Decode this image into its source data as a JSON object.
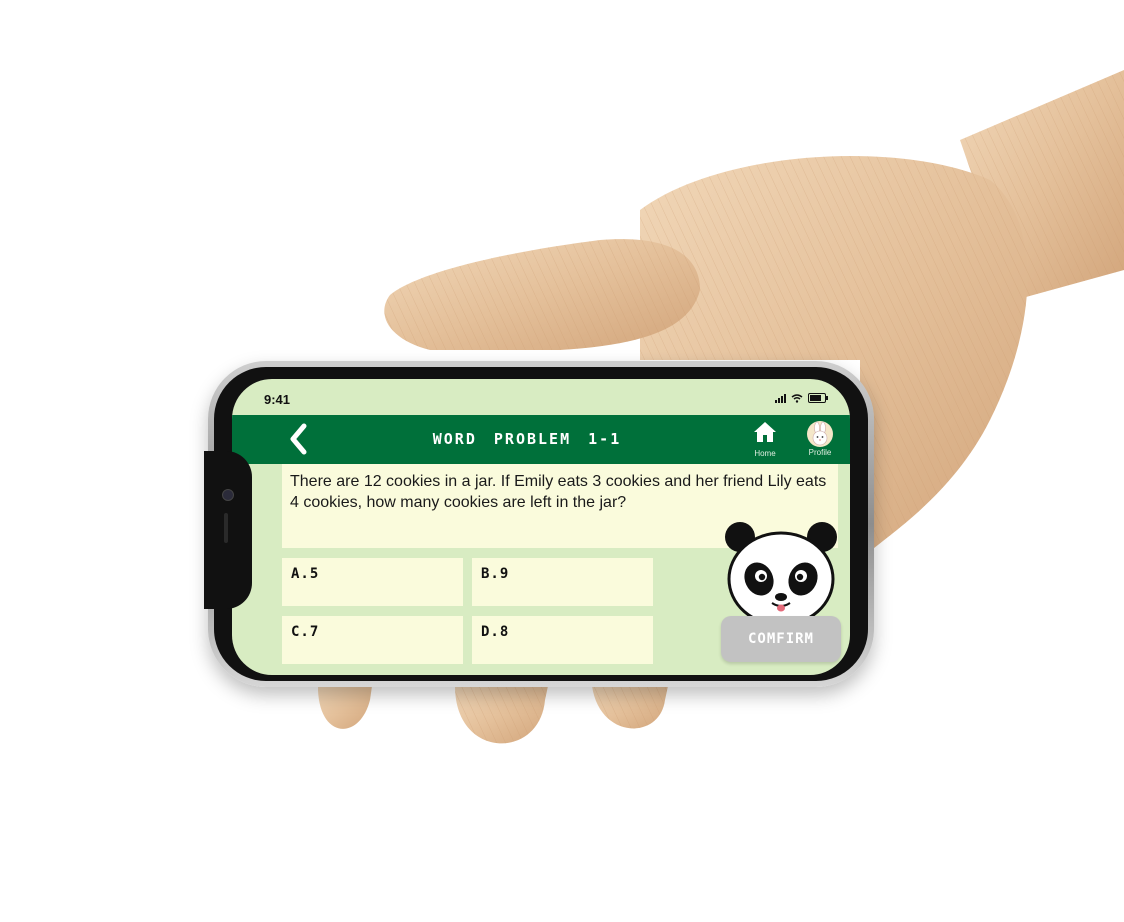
{
  "status_bar": {
    "time": "9:41"
  },
  "header": {
    "title": "WORD PROBLEM 1-1",
    "home_label": "Home",
    "profile_label": "Profile"
  },
  "question": {
    "text": "There are 12 cookies in a jar. If Emily eats 3 cookies and her friend Lily eats 4 cookies, how many cookies are left in the jar?"
  },
  "options": [
    {
      "label": "A.5"
    },
    {
      "label": "B.9"
    },
    {
      "label": "C.7"
    },
    {
      "label": "D.8"
    }
  ],
  "confirm_label": "COMFIRM",
  "icons": {
    "back": "chevron-left-icon",
    "home": "home-icon",
    "profile": "bunny-avatar-icon",
    "mascot": "panda-mascot"
  },
  "colors": {
    "header": "#00703a",
    "background": "#d8ecc2",
    "card": "#fafbdc",
    "confirm_disabled": "#c2c2c2"
  }
}
